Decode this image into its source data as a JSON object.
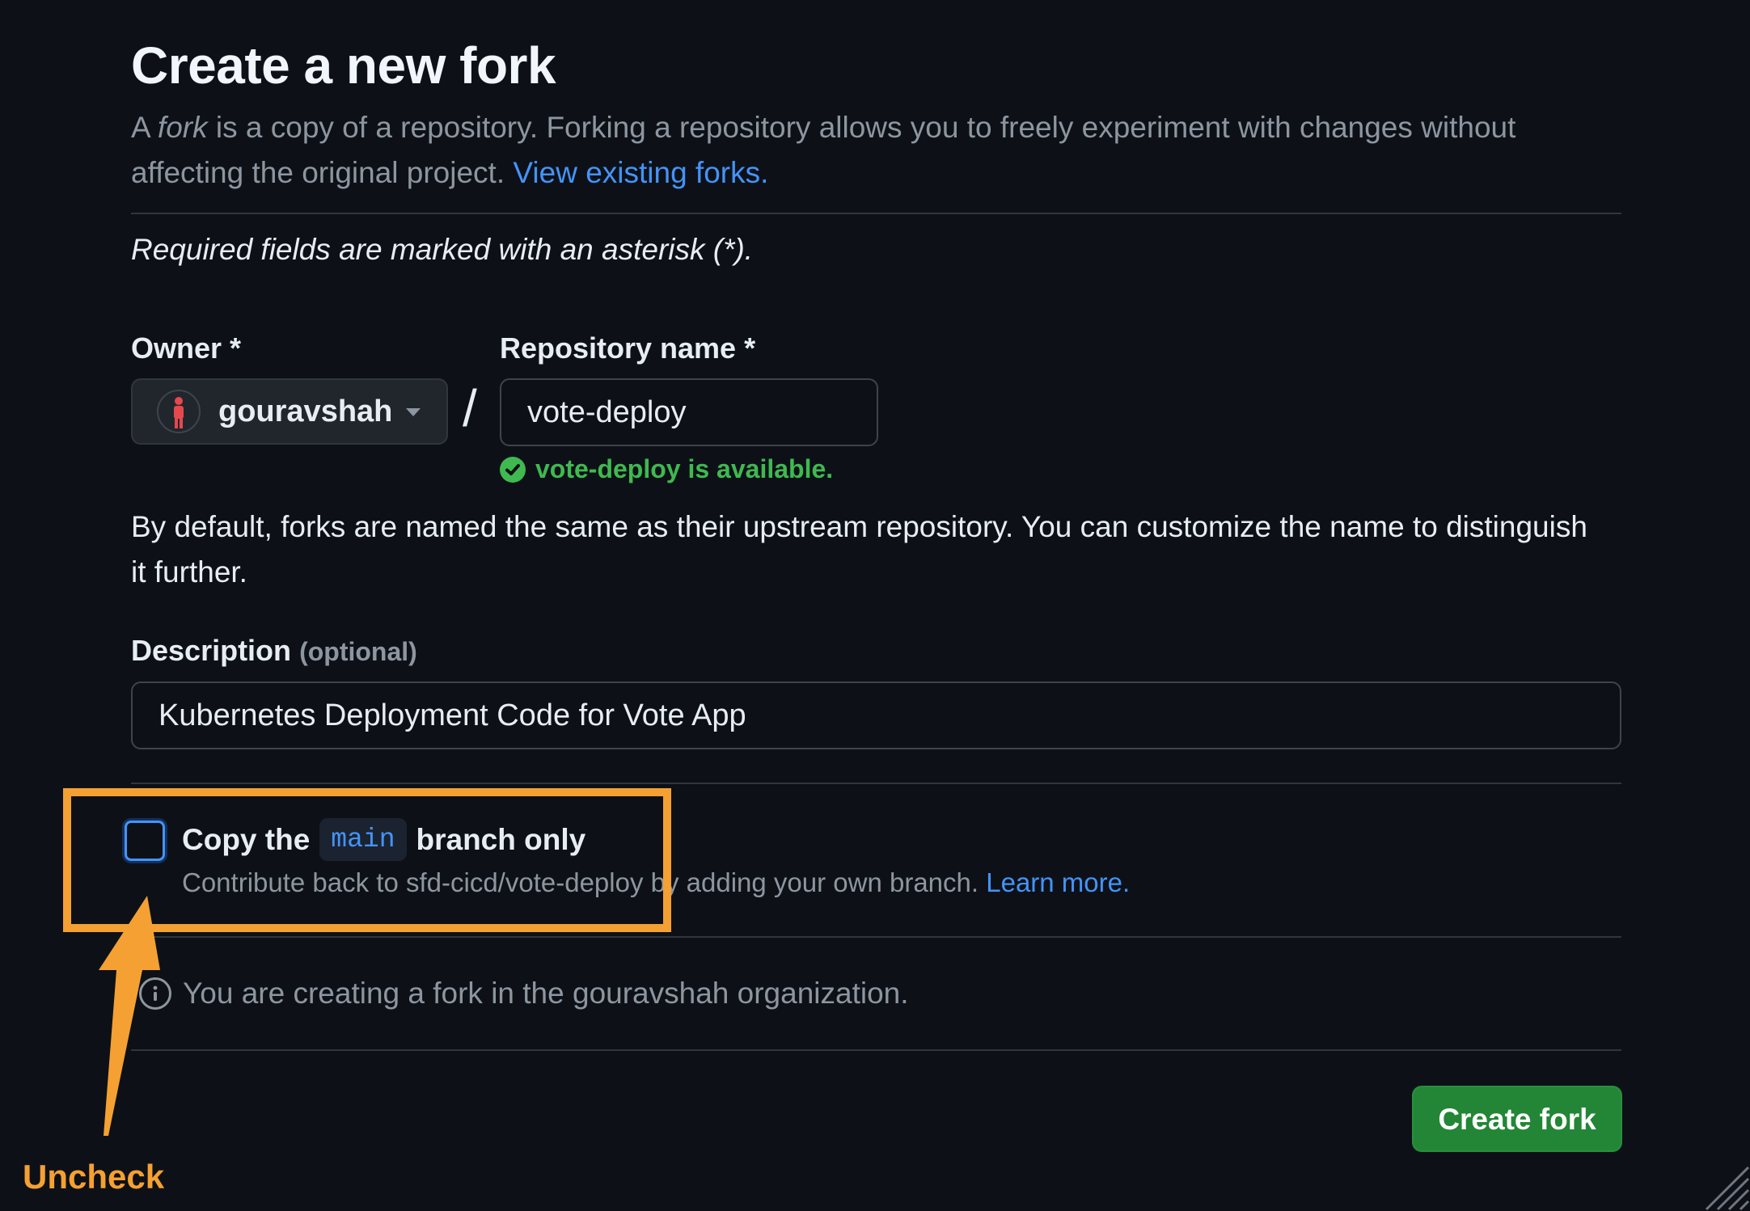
{
  "header": {
    "title": "Create a new fork",
    "lead_prefix": "A ",
    "lead_emphasis": "fork",
    "lead_rest": " is a copy of a repository. Forking a repository allows you to freely experiment with changes without affecting the original project. ",
    "lead_link": "View existing forks."
  },
  "form": {
    "required_note": "Required fields are marked with an asterisk (*).",
    "owner": {
      "label": "Owner *",
      "value": "gouravshah"
    },
    "separator": "/",
    "repo": {
      "label": "Repository name *",
      "value": "vote-deploy",
      "availability": "vote-deploy is available."
    },
    "naming_help": "By default, forks are named the same as their upstream repository. You can customize the name to distinguish it further.",
    "description": {
      "label": "Description",
      "optional": "(optional)",
      "value": "Kubernetes Deployment Code for Vote App"
    },
    "copy_branch": {
      "checked": false,
      "label_prefix": "Copy the",
      "branch": "main",
      "label_suffix": "branch only",
      "sub_text": "Contribute back to sfd-cicd/vote-deploy by adding your own branch. ",
      "sub_link": "Learn more."
    },
    "info": "You are creating a fork in the gouravshah organization.",
    "submit_label": "Create fork"
  },
  "annotation": {
    "text": "Uncheck",
    "color": "#f5a033"
  },
  "colors": {
    "background": "#0d1117",
    "link": "#4493f8",
    "success": "#3fb950",
    "primary_button": "#238636"
  }
}
